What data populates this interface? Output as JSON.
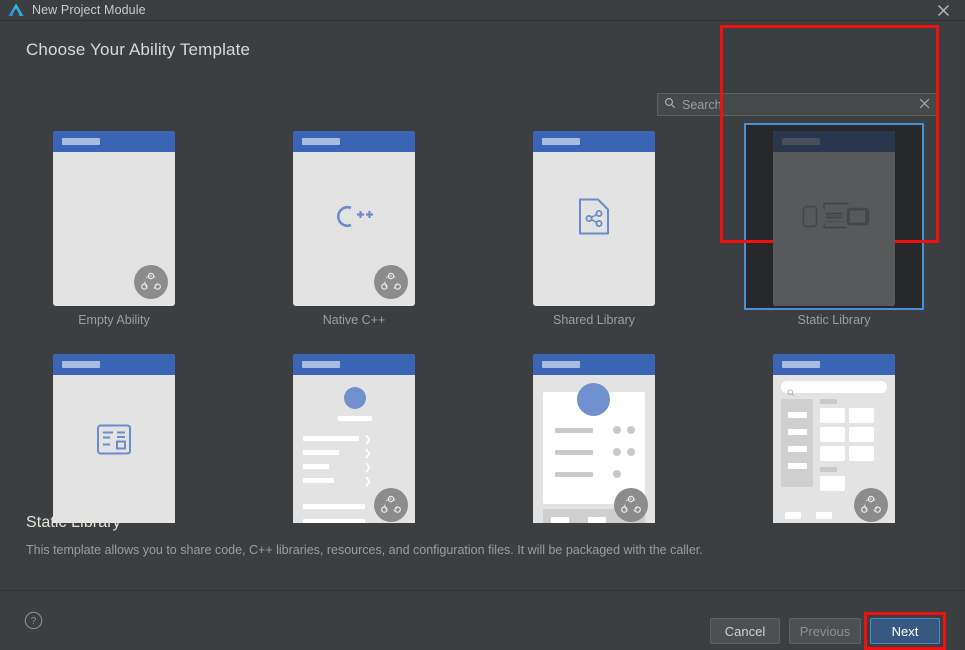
{
  "window": {
    "title": "New Project Module",
    "logo_icon": "deveco-logo-icon",
    "close_icon": "close-icon"
  },
  "heading": "Choose Your Ability Template",
  "search": {
    "placeholder": "Search",
    "value": "",
    "search_icon": "search-icon",
    "clear_icon": "clear-icon"
  },
  "templates": [
    {
      "label": "Empty Ability",
      "icon": "blank-page-icon",
      "badge": "distributed-devices-icon",
      "selected": false
    },
    {
      "label": "Native C++",
      "icon": "cpp-logo-icon",
      "badge": "distributed-devices-icon",
      "selected": false
    },
    {
      "label": "Shared Library",
      "icon": "share-document-icon",
      "badge": "none",
      "selected": false
    },
    {
      "label": "Static Library",
      "icon": "linked-devices-icon",
      "badge": "none",
      "selected": true
    },
    {
      "label": "",
      "icon": "form-layout-icon",
      "badge": "none",
      "selected": false
    },
    {
      "label": "",
      "icon": "profile-list-icon",
      "badge": "distributed-devices-icon",
      "selected": false
    },
    {
      "label": "",
      "icon": "card-profile-icon",
      "badge": "distributed-devices-icon",
      "selected": false
    },
    {
      "label": "",
      "icon": "category-grid-icon",
      "badge": "distributed-devices-icon",
      "selected": false
    }
  ],
  "description": {
    "title": "Static Library",
    "text": "This template allows you to share code, C++ libraries, resources, and configuration files. It will be packaged with the caller."
  },
  "footer": {
    "help_icon": "help-icon",
    "cancel_label": "Cancel",
    "previous_label": "Previous",
    "next_label": "Next"
  },
  "colors": {
    "accent_blue": "#3c64b4",
    "selection_blue": "#4a90d9",
    "primary_button": "#365880",
    "highlight_red": "#f40f0f",
    "dialog_bg": "#3c3f41",
    "card_bg": "#e3e3e3"
  }
}
